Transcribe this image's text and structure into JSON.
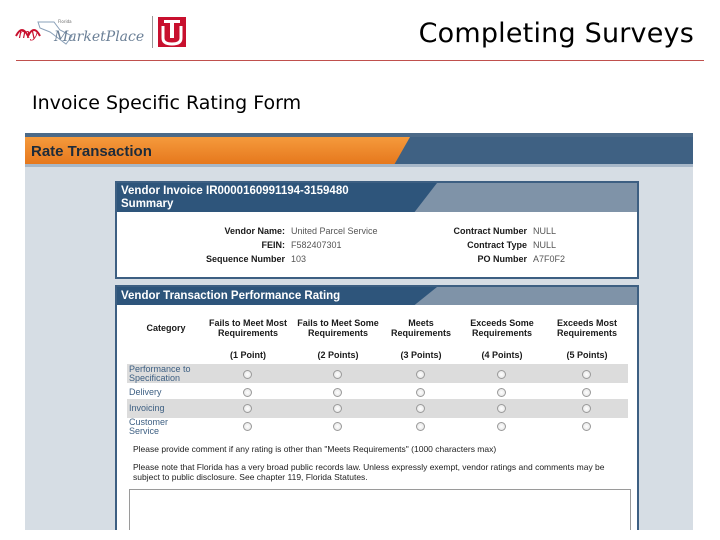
{
  "slide": {
    "title": "Completing Surveys",
    "subtitle": "Invoice Specific Rating Form",
    "logo_text": "myFloridaMarketPlace",
    "colors": {
      "rule": "#c0504d",
      "logo_red": "#c8102e"
    }
  },
  "app": {
    "header_title": "Rate Transaction",
    "summary": {
      "title_line1": "Vendor Invoice  IR0000160991194-3159480",
      "title_line2": "Summary",
      "fields_left": [
        {
          "label": "Vendor Name:",
          "value": "United Parcel Service"
        },
        {
          "label": "FEIN:",
          "value": "F582407301"
        },
        {
          "label": "Sequence Number",
          "value": "103"
        }
      ],
      "fields_right": [
        {
          "label": "Contract Number",
          "value": "NULL"
        },
        {
          "label": "Contract Type",
          "value": "NULL"
        },
        {
          "label": "PO Number",
          "value": "A7F0F2"
        }
      ]
    },
    "rating": {
      "title": "Vendor Transaction Performance Rating",
      "category_header": "Category",
      "columns": [
        {
          "label": "Fails to Meet Most Requirements",
          "points": "(1 Point)"
        },
        {
          "label": "Fails to Meet Some Requirements",
          "points": "(2 Points)"
        },
        {
          "label": "Meets Requirements",
          "points": "(3 Points)"
        },
        {
          "label": "Exceeds Some Requirements",
          "points": "(4 Points)"
        },
        {
          "label": "Exceeds Most Requirements",
          "points": "(5 Points)"
        }
      ],
      "rows": [
        {
          "label": "Performance to Specification"
        },
        {
          "label": "Delivery"
        },
        {
          "label": "Invoicing"
        },
        {
          "label": "Customer Service"
        }
      ],
      "note_comment": "Please provide comment if any rating is other than \"Meets Requirements\" (1000 characters max)",
      "note_public": "Please note that Florida has a very broad public records law. Unless expressly exempt, vendor ratings and comments may be subject to public disclosure. See chapter 119, Florida Statutes."
    }
  }
}
